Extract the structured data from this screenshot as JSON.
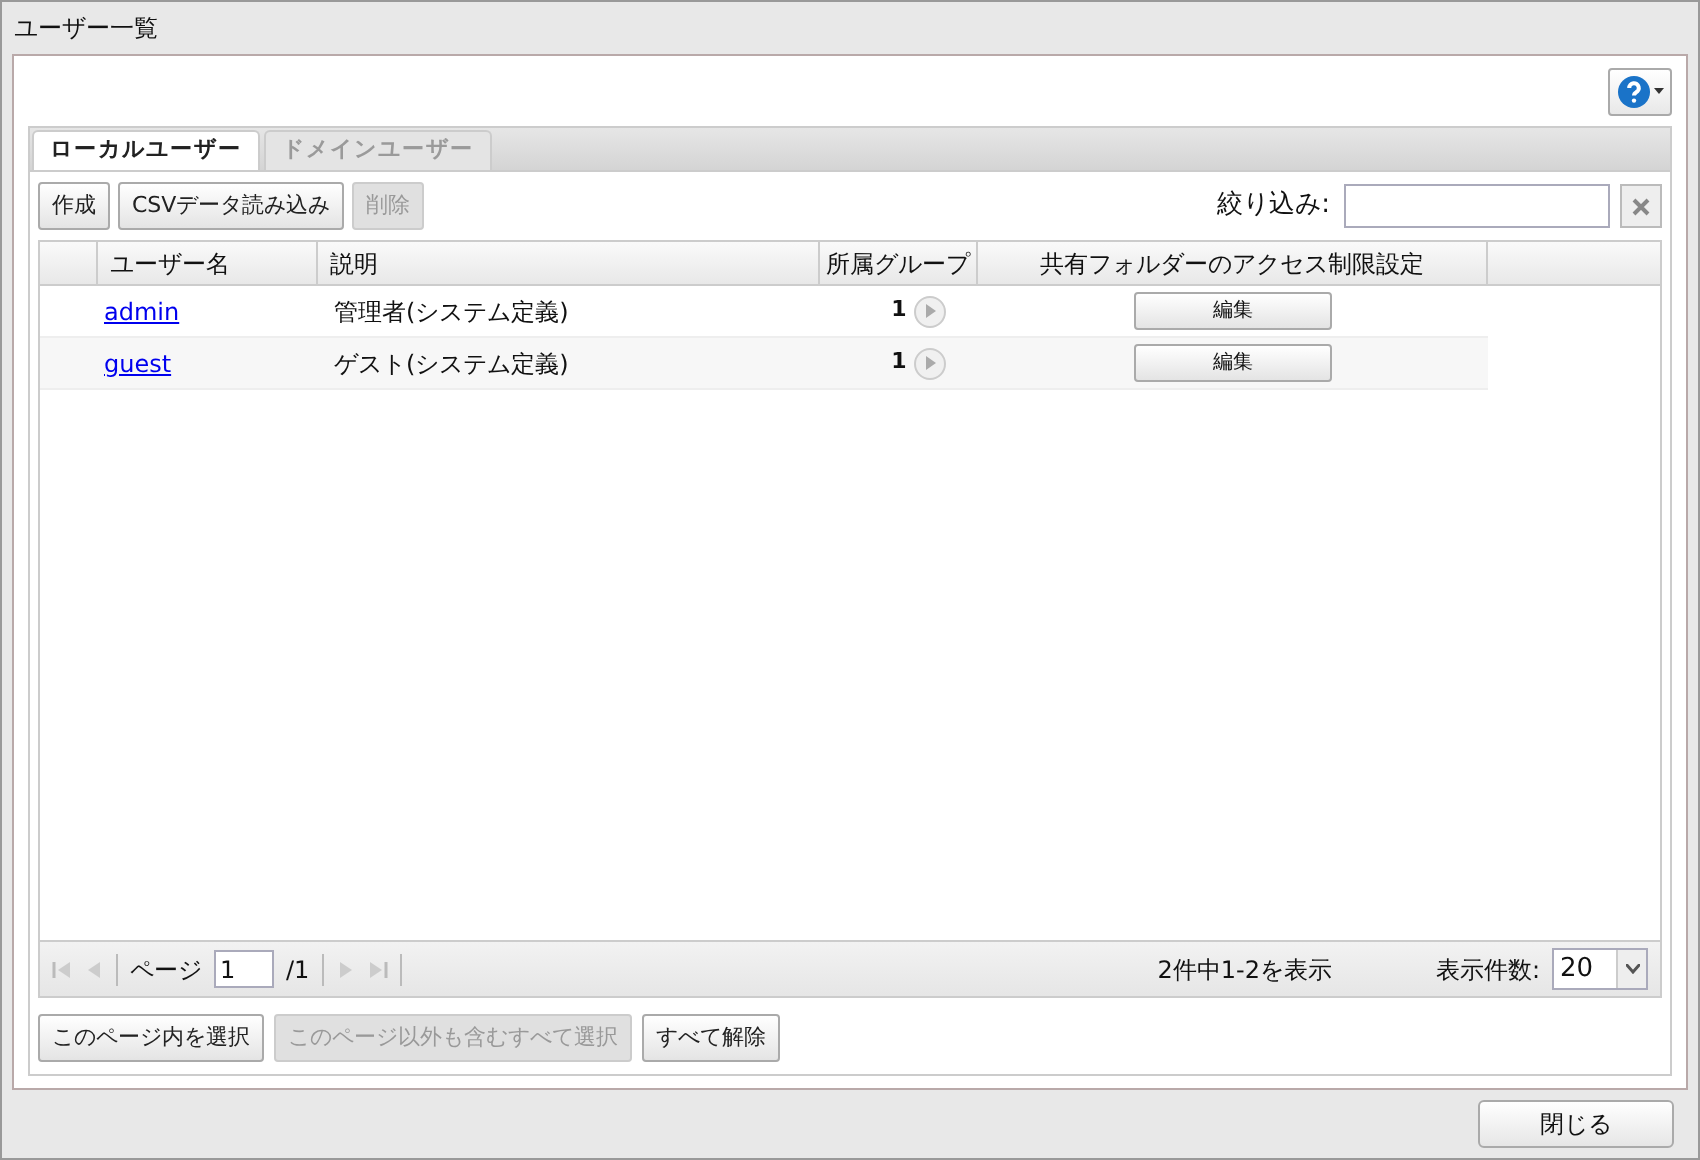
{
  "window": {
    "title": "ユーザー一覧"
  },
  "tabs": [
    {
      "label": "ローカルユーザー",
      "selected": true
    },
    {
      "label": "ドメインユーザー",
      "selected": false
    }
  ],
  "toolbar": {
    "buttons": [
      {
        "label": "作成",
        "disabled": false
      },
      {
        "label": "CSVデータ読み込み",
        "disabled": false
      },
      {
        "label": "削除",
        "disabled": true
      }
    ],
    "filter": {
      "label": "絞り込み:"
    }
  },
  "table": {
    "columns": [
      "ユーザー名",
      "説明",
      "所属グループ",
      "共有フォルダーのアクセス制限設定"
    ],
    "rows": [
      {
        "name": "admin",
        "description": "管理者(システム定義)",
        "groups": "1",
        "action": "編集"
      },
      {
        "name": "guest",
        "description": "ゲスト(システム定義)",
        "groups": "1",
        "action": "編集"
      }
    ]
  },
  "pager": {
    "page_label": "ページ",
    "page": "1",
    "total": "/1",
    "summary": "2件中1-2を表示",
    "page_size_label": "表示件数:",
    "page_size": "20"
  },
  "selection_buttons": [
    {
      "label": "このページ内を選択",
      "disabled": false
    },
    {
      "label": "このページ以外も含むすべて選択",
      "disabled": true
    },
    {
      "label": "すべて解除",
      "disabled": false
    }
  ],
  "footer": {
    "close": "閉じる"
  }
}
